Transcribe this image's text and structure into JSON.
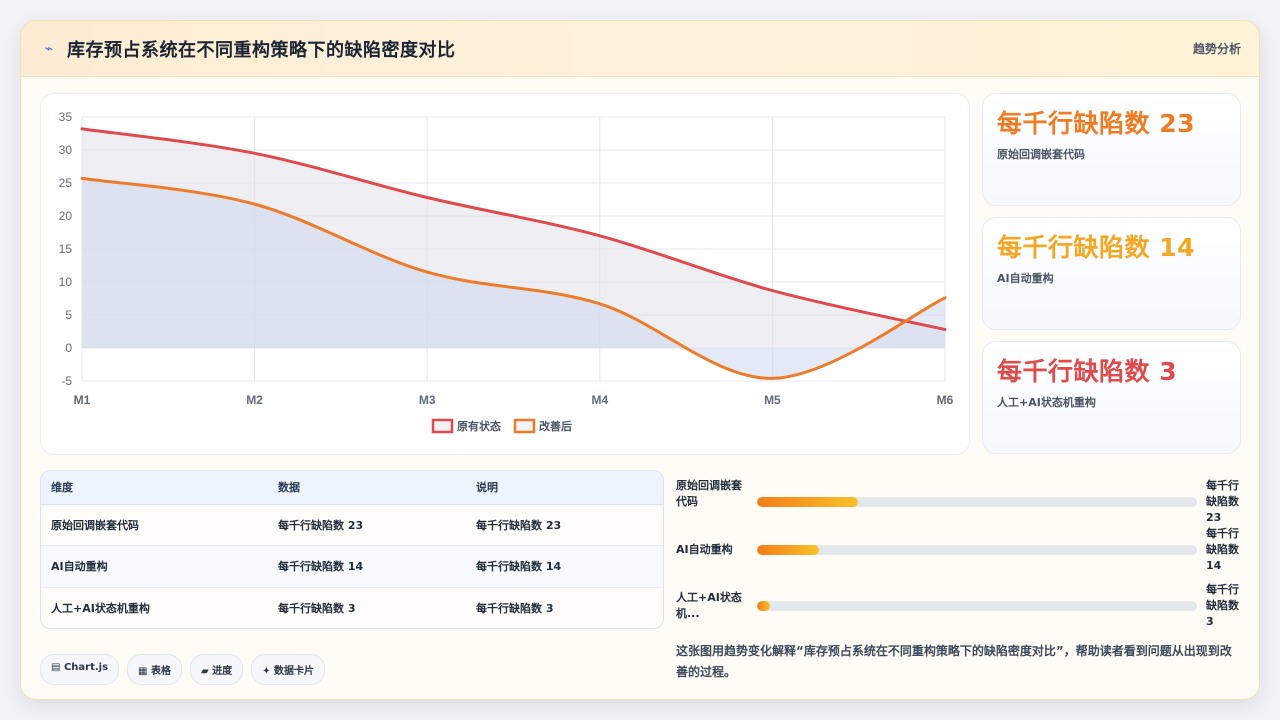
{
  "header": {
    "icon": "trend-line-icon",
    "title": "库存预占系统在不同重构策略下的缺陷密度对比",
    "tag": "趋势分析"
  },
  "chart_data": {
    "type": "area",
    "categories": [
      "M1",
      "M2",
      "M3",
      "M4",
      "M5",
      "M6"
    ],
    "ylim": [
      -5,
      35
    ],
    "yticks": [
      -5,
      0,
      5,
      10,
      15,
      20,
      25,
      30,
      35
    ],
    "grid": true,
    "legend_position": "bottom",
    "series": [
      {
        "name": "原有状态",
        "values": [
          33.2,
          29.5,
          22.8,
          17.0,
          8.7,
          2.8
        ],
        "color": "#e04a4a",
        "fill": "rgba(225,226,233,0.55)"
      },
      {
        "name": "改善后",
        "values": [
          25.7,
          21.8,
          11.5,
          6.7,
          -4.6,
          7.6
        ],
        "color": "#ee7b2a",
        "fill": "rgba(205,215,238,0.55)"
      }
    ]
  },
  "kpis": [
    {
      "value": "每千行缺陷数 23",
      "label": "原始回调嵌套代码",
      "color": "#ef7b22"
    },
    {
      "value": "每千行缺陷数 14",
      "label": "AI自动重构",
      "color": "#f5a623"
    },
    {
      "value": "每千行缺陷数 3",
      "label": "人工+AI状态机重构",
      "color": "#e04a4a"
    }
  ],
  "table": {
    "headers": [
      "维度",
      "数据",
      "说明"
    ],
    "rows": [
      [
        "原始回调嵌套代码",
        "每千行缺陷数 23",
        "每千行缺陷数 23"
      ],
      [
        "AI自动重构",
        "每千行缺陷数 14",
        "每千行缺陷数 14"
      ],
      [
        "人工+AI状态机重构",
        "每千行缺陷数 3",
        "每千行缺陷数 3"
      ]
    ]
  },
  "progress": [
    {
      "label": "原始回调嵌套代码",
      "value_text": "每千行缺陷数 23",
      "value": 23
    },
    {
      "label": "AI自动重构",
      "value_text": "每千行缺陷数 14",
      "value": 14
    },
    {
      "label": "人工+AI状态机...",
      "value_text": "每千行缺陷数 3",
      "value": 3
    }
  ],
  "chips": [
    {
      "icon": "chart-icon",
      "glyph": "▤",
      "label": "Chart.js"
    },
    {
      "icon": "table-icon",
      "glyph": "▦",
      "label": "表格"
    },
    {
      "icon": "progress-icon",
      "glyph": "▰",
      "label": "进度"
    },
    {
      "icon": "card-icon",
      "glyph": "✦",
      "label": "数据卡片"
    }
  ],
  "summary": "这张图用趋势变化解释“库存预占系统在不同重构策略下的缺陷密度对比”，帮助读者看到问题从出现到改善的过程。"
}
